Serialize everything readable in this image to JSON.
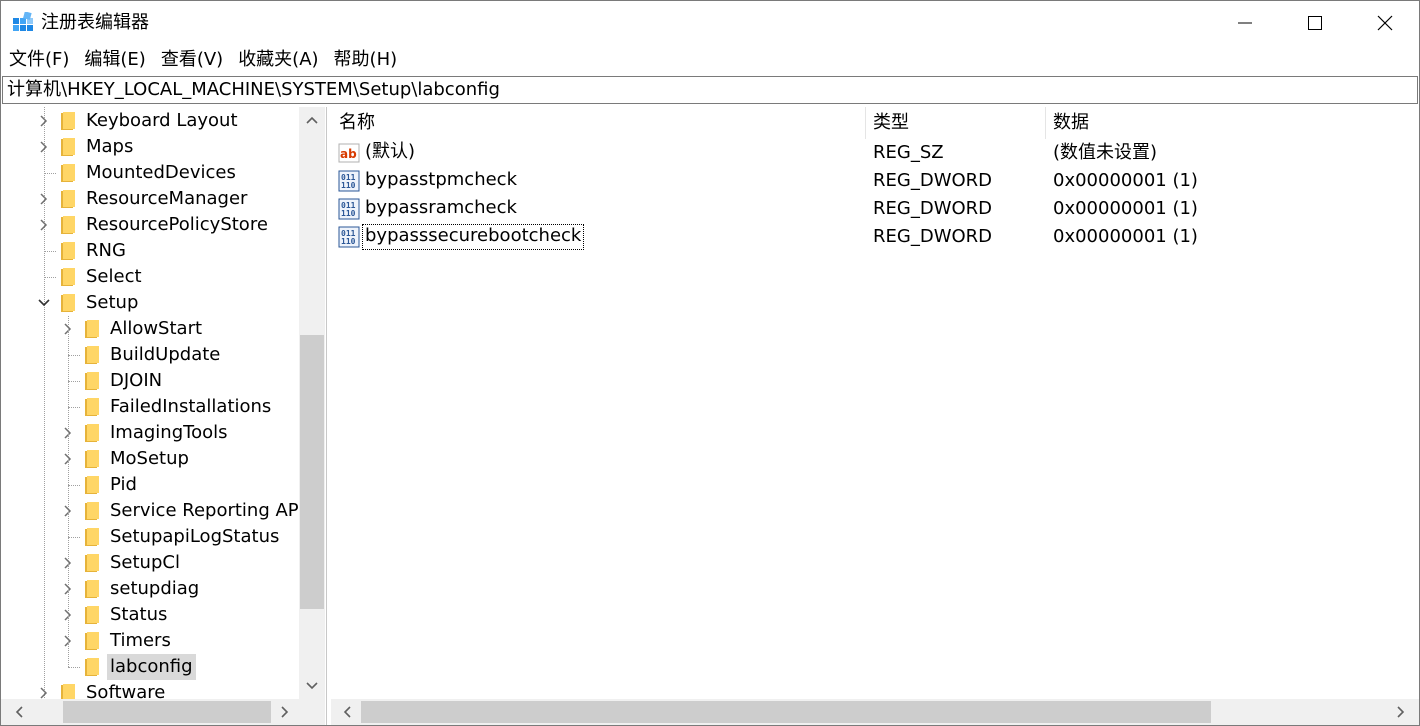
{
  "window": {
    "title": "注册表编辑器"
  },
  "menu": [
    "文件(F)",
    "编辑(E)",
    "查看(V)",
    "收藏夹(A)",
    "帮助(H)"
  ],
  "address": "计算机\\HKEY_LOCAL_MACHINE\\SYSTEM\\Setup\\labconfig",
  "tree": {
    "items": [
      {
        "label": "Keyboard Layout",
        "expander": "collapsed",
        "selected": false
      },
      {
        "label": "Maps",
        "expander": "collapsed",
        "selected": false
      },
      {
        "label": "MountedDevices",
        "expander": "none",
        "selected": false
      },
      {
        "label": "ResourceManager",
        "expander": "collapsed",
        "selected": false
      },
      {
        "label": "ResourcePolicyStore",
        "expander": "collapsed",
        "selected": false
      },
      {
        "label": "RNG",
        "expander": "none",
        "selected": false
      },
      {
        "label": "Select",
        "expander": "none",
        "selected": false
      },
      {
        "label": "Setup",
        "expander": "expanded",
        "selected": false
      },
      {
        "label": "AllowStart",
        "expander": "collapsed",
        "selected": false
      },
      {
        "label": "BuildUpdate",
        "expander": "none",
        "selected": false
      },
      {
        "label": "DJOIN",
        "expander": "none",
        "selected": false
      },
      {
        "label": "FailedInstallations",
        "expander": "none",
        "selected": false
      },
      {
        "label": "ImagingTools",
        "expander": "collapsed",
        "selected": false
      },
      {
        "label": "MoSetup",
        "expander": "collapsed",
        "selected": false
      },
      {
        "label": "Pid",
        "expander": "none",
        "selected": false
      },
      {
        "label": "Service Reporting API",
        "expander": "collapsed",
        "selected": false
      },
      {
        "label": "SetupapiLogStatus",
        "expander": "none",
        "selected": false
      },
      {
        "label": "SetupCl",
        "expander": "collapsed",
        "selected": false
      },
      {
        "label": "setupdiag",
        "expander": "collapsed",
        "selected": false
      },
      {
        "label": "Status",
        "expander": "collapsed",
        "selected": false
      },
      {
        "label": "Timers",
        "expander": "collapsed",
        "selected": false
      },
      {
        "label": "labconfig",
        "expander": "none",
        "selected": true
      },
      {
        "label": "Software",
        "expander": "collapsed",
        "selected": false
      }
    ]
  },
  "values": {
    "columns": {
      "name": "名称",
      "type": "类型",
      "data": "数据"
    },
    "rows": [
      {
        "icon": "string-value-icon",
        "name": "(默认)",
        "type": "REG_SZ",
        "data": "(数值未设置)",
        "focused": false
      },
      {
        "icon": "binary-value-icon",
        "name": "bypasstpmcheck",
        "type": "REG_DWORD",
        "data": "0x00000001 (1)",
        "focused": false
      },
      {
        "icon": "binary-value-icon",
        "name": "bypassramcheck",
        "type": "REG_DWORD",
        "data": "0x00000001 (1)",
        "focused": false
      },
      {
        "icon": "binary-value-icon",
        "name": "bypasssecurebootcheck",
        "type": "REG_DWORD",
        "data": "0x00000001 (1)",
        "focused": true
      }
    ]
  },
  "colors": {
    "folder": "#ffd666",
    "folder_dark": "#e6b33a",
    "selection": "#d9d9d9",
    "scroll_track": "#f0f0f0",
    "scroll_thumb": "#cdcdcd",
    "reg_sz_red": "#d83b01",
    "reg_dword_blue": "#2b5797"
  }
}
